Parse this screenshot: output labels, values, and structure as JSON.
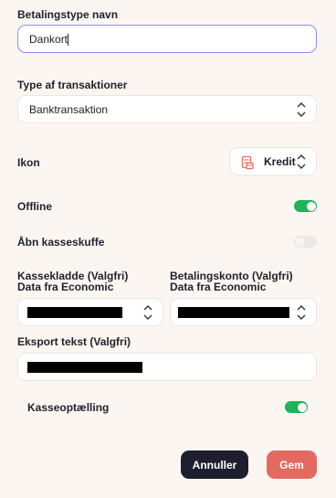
{
  "payment_type_name": {
    "label": "Betalingstype navn",
    "value": "Dankort"
  },
  "transaction_type": {
    "label": "Type af transaktioner",
    "value": "Banktransaktion"
  },
  "icon": {
    "label": "Ikon",
    "value": "Kredit",
    "icon_name": "credit-receipt-icon",
    "icon_color": "#e46a60"
  },
  "offline": {
    "label": "Offline",
    "enabled": true
  },
  "open_drawer": {
    "label": "Åbn kasseskuffe",
    "enabled": false
  },
  "cashbook": {
    "label_line1": "Kassekladde (Valgfri)",
    "label_line2": "Data fra Economic"
  },
  "payment_account": {
    "label_line1": "Betalingskonto (Valgfri)",
    "label_line2": "Data fra Economic"
  },
  "export_text": {
    "label": "Eksport tekst (Valgfri)"
  },
  "cash_count": {
    "label": "Kasseoptælling",
    "enabled": true
  },
  "actions": {
    "cancel_label": "Annuller",
    "save_label": "Gem"
  },
  "colors": {
    "accent_focus": "#8a8ff0",
    "toggle_on": "#1fb35a",
    "toggle_off": "#ece8e6",
    "cancel_button": "#1e1e30",
    "save_button": "#e46a60",
    "background": "#fcf6f2"
  }
}
